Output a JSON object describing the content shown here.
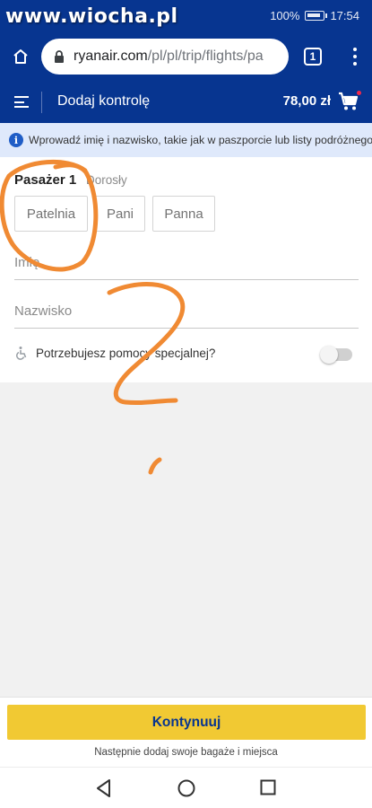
{
  "watermark": "www.wiocha.pl",
  "status_bar": {
    "battery": "100%",
    "time": "17:54"
  },
  "browser": {
    "url_host": "ryanair.com",
    "url_path": "/pl/pl/trip/flights/pa",
    "tab_count": "1"
  },
  "header": {
    "title": "Dodaj kontrolę",
    "price": "78,00 zł"
  },
  "info": {
    "text": "Wprowadź imię i nazwisko, takie jak w paszporcie lub listy podróżnego"
  },
  "passenger": {
    "title": "Pasażer 1",
    "type": "Dorosły",
    "title_options": [
      "Patelnia",
      "Pani",
      "Panna"
    ],
    "first_name_label": "Imię",
    "last_name_label": "Nazwisko",
    "assistance_label": "Potrzebujesz pomocy specjalnej?"
  },
  "footer": {
    "continue_label": "Kontynuuj",
    "next_note": "Następnie dodaj swoje bagaże i miejsca"
  },
  "colors": {
    "brand": "#073590",
    "accent": "#f1c933",
    "info_bg": "#dfe9fb",
    "annotation": "#f08a33"
  },
  "icons": [
    "wifi-icon",
    "home-icon",
    "lock-icon",
    "tabs-icon",
    "overflow-menu-icon",
    "hamburger-icon",
    "cart-icon",
    "info-icon",
    "wheelchair-icon",
    "nav-back-icon",
    "nav-home-icon",
    "nav-recent-icon"
  ]
}
